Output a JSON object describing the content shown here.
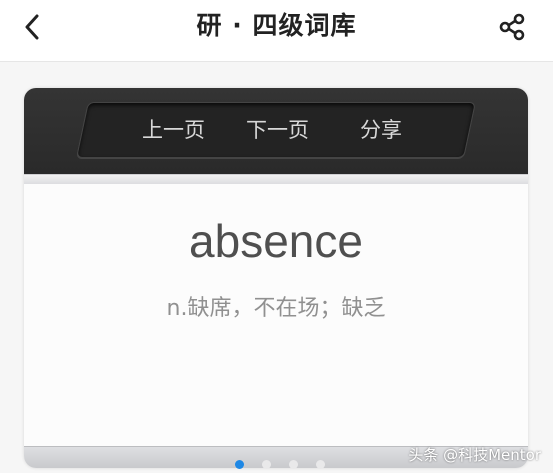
{
  "navbar": {
    "title": "研 · 四级词库",
    "back_icon": "chevron-left-icon",
    "share_icon": "share-icon"
  },
  "card": {
    "pager": {
      "prev_label": "上一页",
      "next_label": "下一页",
      "share_label": "分享"
    },
    "word": "absence",
    "definition": "n.缺席，不在场；缺乏"
  },
  "pagination": {
    "total": 4,
    "active_index": 0,
    "active_color": "#1e88e5"
  },
  "watermark": "头条 @科技Mentor"
}
